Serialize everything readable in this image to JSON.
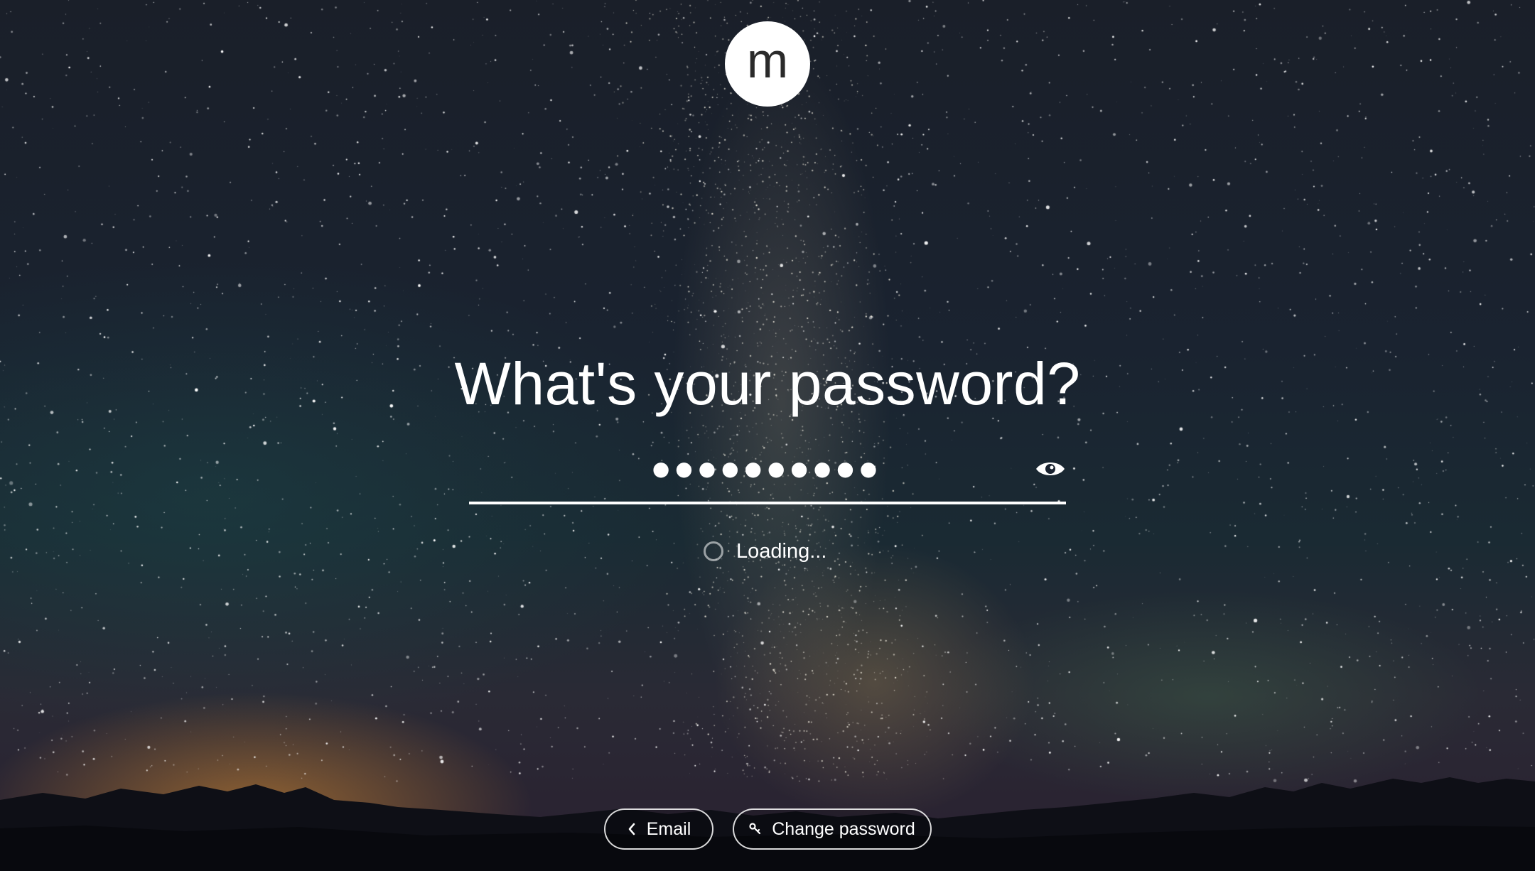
{
  "logo": {
    "letter": "m"
  },
  "title": "What's your password?",
  "password": {
    "masked_value": "●●●●●●●●●●"
  },
  "icons": {
    "show_password": "eye-icon",
    "spinner": "loading-spinner-icon",
    "back": "chevron-left-icon",
    "key": "key-icon"
  },
  "status": {
    "loading_text": "Loading..."
  },
  "footer": {
    "email_label": "Email",
    "change_password_label": "Change password"
  },
  "colors": {
    "text": "#ffffff",
    "logo_bg": "#ffffff",
    "logo_text": "#2a2a2a"
  }
}
